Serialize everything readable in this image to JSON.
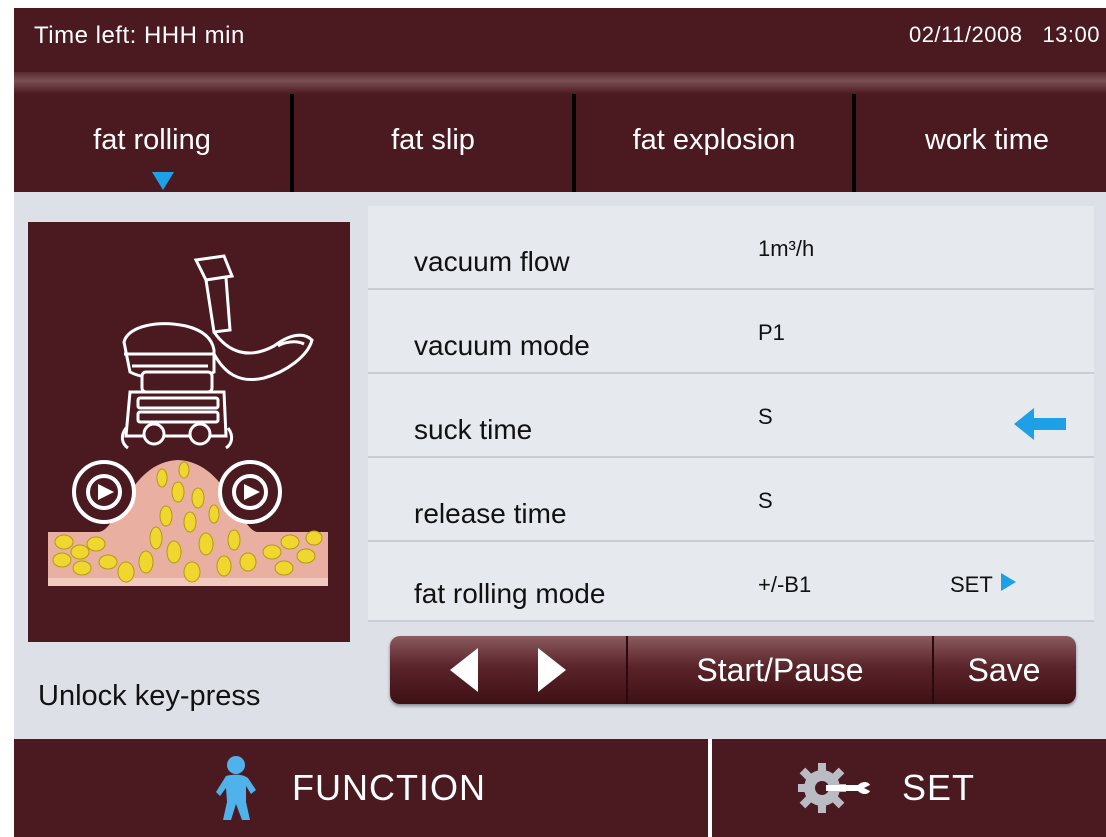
{
  "header": {
    "time_left": "Time left:  HHH min",
    "date": "02/11/2008",
    "time": "13:00"
  },
  "tabs": [
    {
      "label": "fat rolling",
      "selected": true
    },
    {
      "label": "fat slip"
    },
    {
      "label": "fat explosion"
    },
    {
      "label": "work time"
    }
  ],
  "params": [
    {
      "label": "vacuum flow",
      "value": "1m³/h"
    },
    {
      "label": "vacuum mode",
      "value": "P1"
    },
    {
      "label": "suck time",
      "value": "S",
      "active": true
    },
    {
      "label": "release time",
      "value": "S"
    },
    {
      "label": "fat rolling mode",
      "value": "+/-B1",
      "set_label": "SET"
    }
  ],
  "unlock_label": "Unlock key-press",
  "controls": {
    "start_pause": "Start/Pause",
    "save": "Save"
  },
  "footer": {
    "function_label": "FUNCTION",
    "set_label": "SET"
  },
  "colors": {
    "primary_bg": "#4a1a20",
    "accent": "#1ea0e6",
    "panel_bg": "#dde1e7"
  },
  "icons": [
    "triangle-down-icon",
    "arrow-left-icon",
    "triangle-left-icon",
    "triangle-right-icon",
    "triangle-right-small-icon",
    "person-icon",
    "gear-wrench-icon"
  ]
}
